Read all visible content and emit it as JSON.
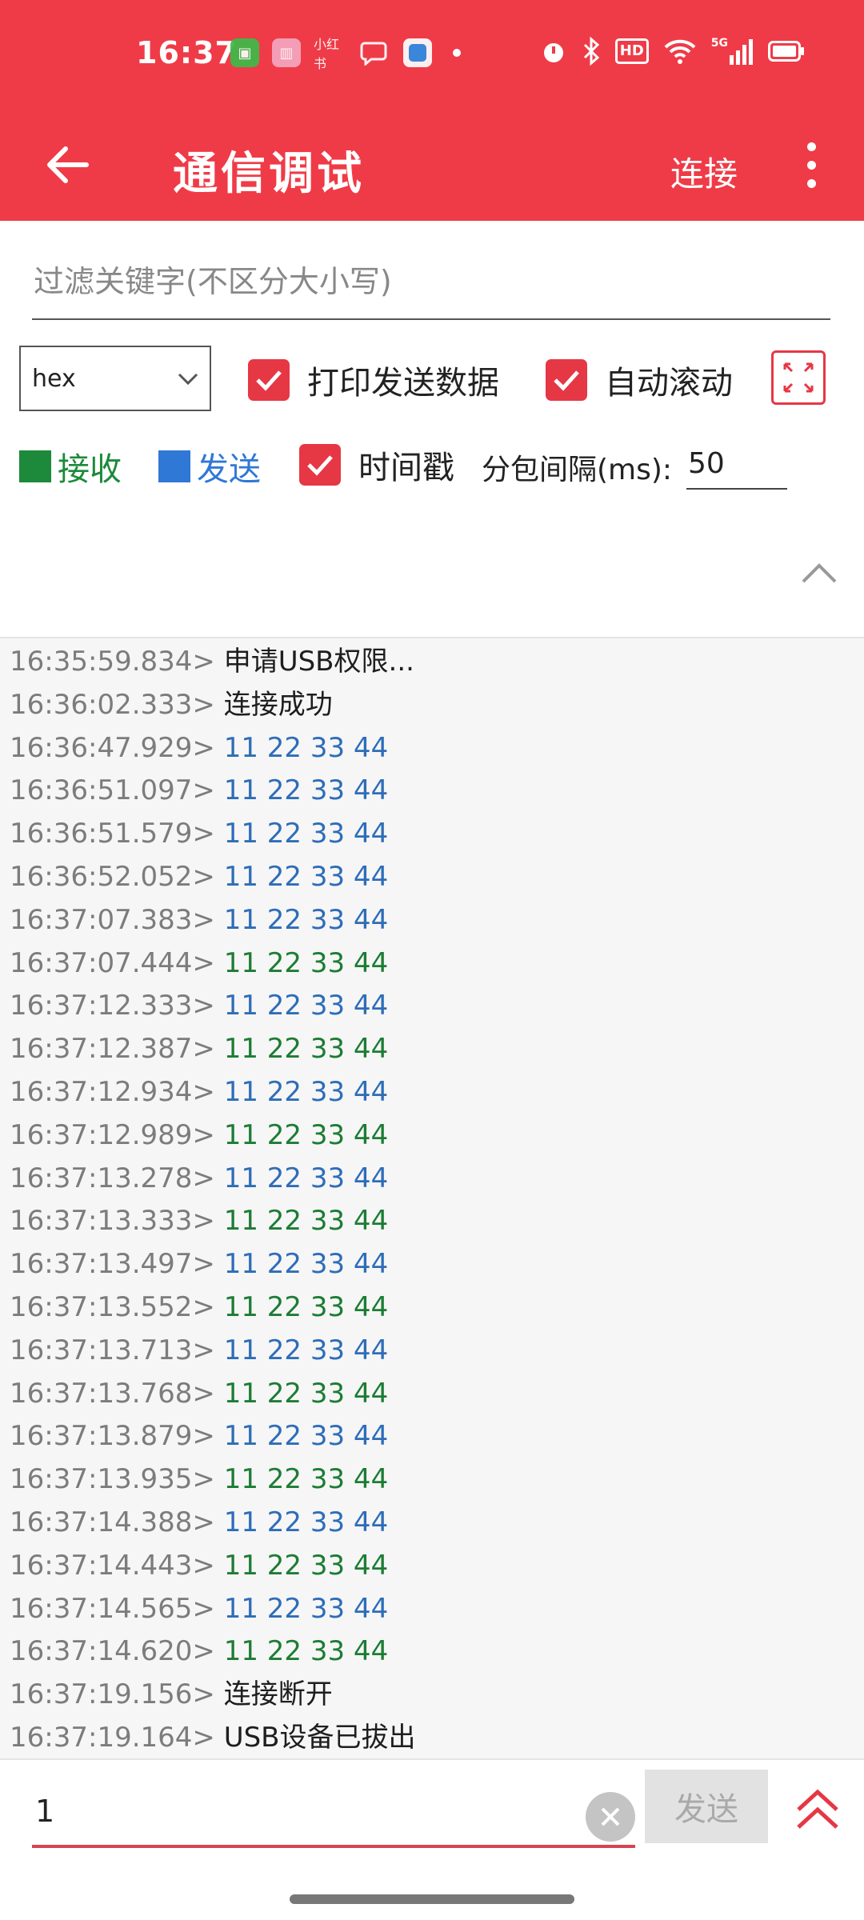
{
  "status_bar": {
    "time": "16:37",
    "app_icons": [
      "green-app-icon",
      "pink-app-icon",
      "xiaohongshu-text-icon",
      "chat-icon",
      "blue-app-icon"
    ],
    "small_text_icon": "小红书",
    "right_icons": [
      "alarm-icon",
      "bluetooth-icon",
      "hd-icon",
      "wifi-icon",
      "5g-signal-icon",
      "battery-icon"
    ],
    "hd_label": "HD",
    "net_label": "5G"
  },
  "app_bar": {
    "title": "通信调试",
    "connect_label": "连接"
  },
  "filter": {
    "placeholder": "过滤关键字(不区分大小写)"
  },
  "controls": {
    "format_selected": "hex",
    "print_send_label": "打印发送数据",
    "auto_scroll_label": "自动滚动",
    "recv_legend": "接收",
    "send_legend": "发送",
    "timestamp_label": "时间戳",
    "interval_label": "分包间隔(ms):",
    "interval_value": "50"
  },
  "log": [
    {
      "ts": "16:35:59.834>",
      "msg": "申请USB权限...",
      "kind": "info"
    },
    {
      "ts": "16:36:02.333>",
      "msg": "连接成功",
      "kind": "info"
    },
    {
      "ts": "16:36:47.929>",
      "msg": "11 22 33 44",
      "kind": "send"
    },
    {
      "ts": "16:36:51.097>",
      "msg": "11 22 33 44",
      "kind": "send"
    },
    {
      "ts": "16:36:51.579>",
      "msg": "11 22 33 44",
      "kind": "send"
    },
    {
      "ts": "16:36:52.052>",
      "msg": "11 22 33 44",
      "kind": "send"
    },
    {
      "ts": "16:37:07.383>",
      "msg": "11 22 33 44",
      "kind": "send"
    },
    {
      "ts": "16:37:07.444>",
      "msg": "11 22 33 44",
      "kind": "recv"
    },
    {
      "ts": "16:37:12.333>",
      "msg": "11 22 33 44",
      "kind": "send"
    },
    {
      "ts": "16:37:12.387>",
      "msg": "11 22 33 44",
      "kind": "recv"
    },
    {
      "ts": "16:37:12.934>",
      "msg": "11 22 33 44",
      "kind": "send"
    },
    {
      "ts": "16:37:12.989>",
      "msg": "11 22 33 44",
      "kind": "recv"
    },
    {
      "ts": "16:37:13.278>",
      "msg": "11 22 33 44",
      "kind": "send"
    },
    {
      "ts": "16:37:13.333>",
      "msg": "11 22 33 44",
      "kind": "recv"
    },
    {
      "ts": "16:37:13.497>",
      "msg": "11 22 33 44",
      "kind": "send"
    },
    {
      "ts": "16:37:13.552>",
      "msg": "11 22 33 44",
      "kind": "recv"
    },
    {
      "ts": "16:37:13.713>",
      "msg": "11 22 33 44",
      "kind": "send"
    },
    {
      "ts": "16:37:13.768>",
      "msg": "11 22 33 44",
      "kind": "recv"
    },
    {
      "ts": "16:37:13.879>",
      "msg": "11 22 33 44",
      "kind": "send"
    },
    {
      "ts": "16:37:13.935>",
      "msg": "11 22 33 44",
      "kind": "recv"
    },
    {
      "ts": "16:37:14.388>",
      "msg": "11 22 33 44",
      "kind": "send"
    },
    {
      "ts": "16:37:14.443>",
      "msg": "11 22 33 44",
      "kind": "recv"
    },
    {
      "ts": "16:37:14.565>",
      "msg": "11 22 33 44",
      "kind": "send"
    },
    {
      "ts": "16:37:14.620>",
      "msg": "11 22 33 44",
      "kind": "recv"
    },
    {
      "ts": "16:37:19.156>",
      "msg": "连接断开",
      "kind": "info"
    },
    {
      "ts": "16:37:19.164>",
      "msg": "USB设备已拔出",
      "kind": "info"
    }
  ],
  "send_bar": {
    "input_value": "1",
    "send_label": "发送"
  },
  "colors": {
    "accent": "#ef3b47",
    "checkbox": "#e63745",
    "recv": "#1c8a3a",
    "send": "#2f78d6"
  }
}
